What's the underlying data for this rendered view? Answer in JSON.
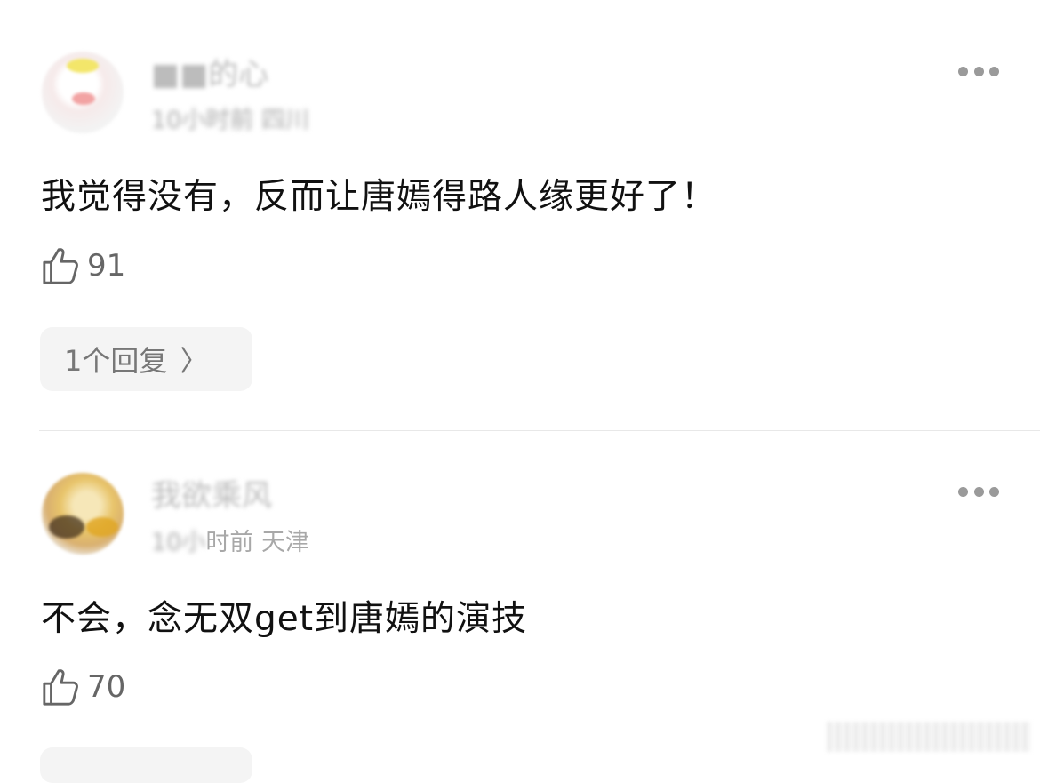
{
  "comments": [
    {
      "username": "■■的心",
      "meta_blurred": "10小时前",
      "meta_location": "四川",
      "text": "我觉得没有，反而让唐嫣得路人缘更好了！",
      "likes": "91",
      "reply_label": "1个回复"
    },
    {
      "username": "我欲乘风",
      "meta_blurred": "10小",
      "meta_time": "时前",
      "meta_location": "天津",
      "text": "不会，念无双get到唐嫣的演技",
      "likes": "70"
    }
  ],
  "icons": {
    "more": "more-dots-icon",
    "like": "thumbs-up-icon",
    "reply_chevron": "chevron-right-icon"
  },
  "colors": {
    "text": "#111111",
    "secondary": "#a8a8a8",
    "reply_bg": "#f4f4f4"
  }
}
